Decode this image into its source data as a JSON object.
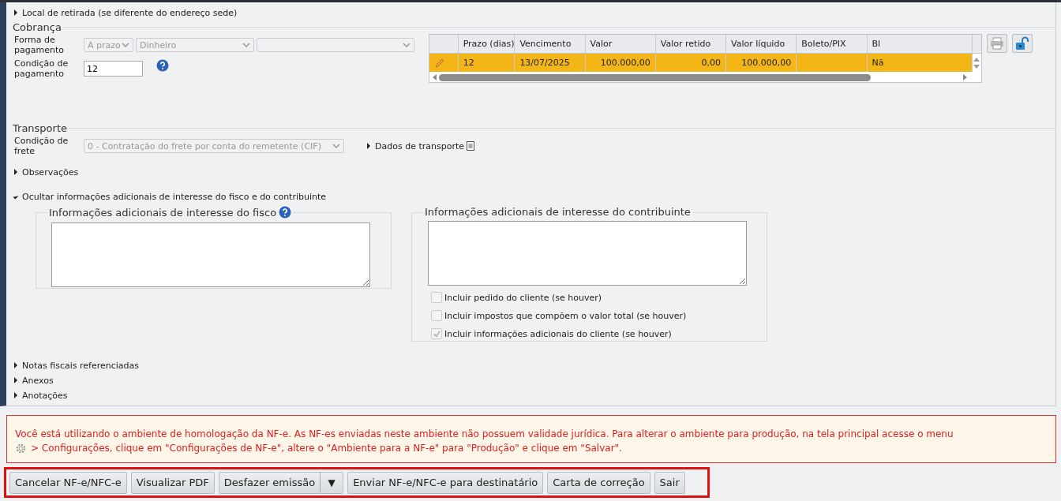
{
  "sections_top": [
    {
      "label": "Local de retirada (se diferente do endereço sede)",
      "expanded": false
    }
  ],
  "cobranca": {
    "legend": "Cobrança",
    "forma_label": "Forma de pagamento",
    "forma_selects": [
      {
        "value": "A prazo",
        "disabled": true
      },
      {
        "value": "Dinheiro",
        "disabled": true
      },
      {
        "disabled": true
      }
    ],
    "condicao_label": "Condição de pagamento",
    "condicao_value": "12",
    "table": {
      "columns": [
        "Prazo (dias)",
        "Vencimento",
        "Valor",
        "Valor retido",
        "Valor líquido",
        "Boleto/PIX",
        "Bl"
      ],
      "rows": [
        {
          "selected": true,
          "cells": [
            "12",
            "13/07/2025",
            "100.000,00",
            "0,00",
            "100.000,00",
            "",
            "Nã"
          ]
        }
      ]
    }
  },
  "transporte": {
    "legend": "Transporte",
    "frete_label": "Condição de frete",
    "frete_value": "0 - Contratação do frete por conta do remetente (CIF)",
    "dados_label": "Dados de transporte",
    "dados_expanded": false
  },
  "sections_mid": [
    {
      "label": "Observações",
      "expanded": false
    },
    {
      "label": "Ocultar informações adicionais de interesse do fisco e do contribuinte",
      "expanded": true
    }
  ],
  "fisco": {
    "legend": "Informações adicionais de interesse do fisco"
  },
  "contribuinte": {
    "legend": "Informações adicionais de interesse do contribuinte",
    "options": [
      {
        "label": "Incluir pedido do cliente (se houver)",
        "checked": false,
        "disabled": true
      },
      {
        "label": "Incluir impostos que compõem o valor total (se houver)",
        "checked": false,
        "disabled": true
      },
      {
        "label": "Incluir informações adicionais do cliente (se houver)",
        "checked": true,
        "disabled": true
      }
    ]
  },
  "sections_bottom": [
    {
      "label": "Notas fiscais referenciadas",
      "expanded": false
    },
    {
      "label": "Anexos",
      "expanded": false
    },
    {
      "label": "Anotações",
      "expanded": false
    }
  ],
  "warning": {
    "line1": "Você está utilizando o ambiente de homologação da NF-e. As NF-es enviadas neste ambiente não possuem validade jurídica. Para alterar o ambiente para produção, na tela principal acesse o menu",
    "line2": "> Configurações, clique em \"Configurações de NF-e\", altere o \"Ambiente para a NF-e\" para \"Produção\" e clique em \"Salvar\"."
  },
  "buttons": [
    {
      "label": "Cancelar NF-e/NFC-e",
      "kind": "plain"
    },
    {
      "label": "Visualizar PDF",
      "kind": "plain"
    },
    {
      "label": "Desfazer emissão",
      "kind": "split",
      "caret": "▼"
    },
    {
      "label": "Enviar NF-e/NFC-e para destinatário",
      "kind": "plain"
    },
    {
      "label": "Carta de correção",
      "kind": "plain"
    },
    {
      "label": "Sair",
      "kind": "plain"
    }
  ]
}
